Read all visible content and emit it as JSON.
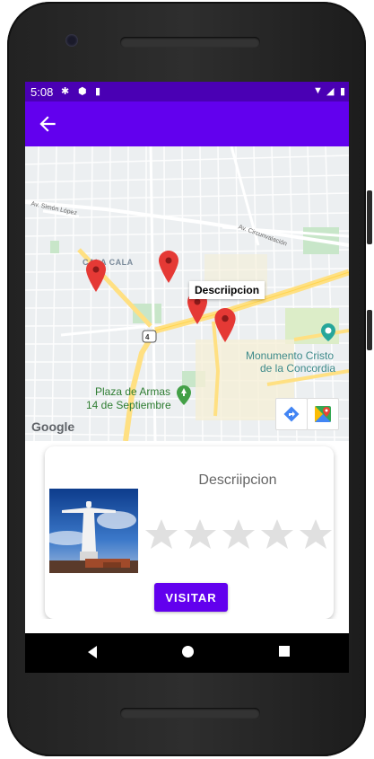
{
  "statusbar": {
    "time": "5:08"
  },
  "appbar": {
    "back_icon": "arrow-left-icon"
  },
  "map": {
    "labels": {
      "cala_cala": "CALA CALA",
      "av_simon": "Av. Simón López",
      "av_circunvalacion": "Av. Circunvalación",
      "monumento_line1": "Monumento Cristo",
      "monumento_line2": "de la Concordia",
      "plaza_line1": "Plaza de Armas",
      "plaza_line2": "14 de Septiembre",
      "route_shield": "4",
      "google": "Google"
    },
    "tooltip": "Descriipcion",
    "colors": {
      "road_major": "#ffe082",
      "park": "#c8e6c9",
      "marker": "#e53935",
      "poi": "#26a69a"
    }
  },
  "card": {
    "title": "Descriipcion",
    "rating": 0,
    "rating_max": 5,
    "button_label": "VISITAR"
  },
  "colors": {
    "primary": "#6200ee",
    "status": "#4a00b4"
  }
}
